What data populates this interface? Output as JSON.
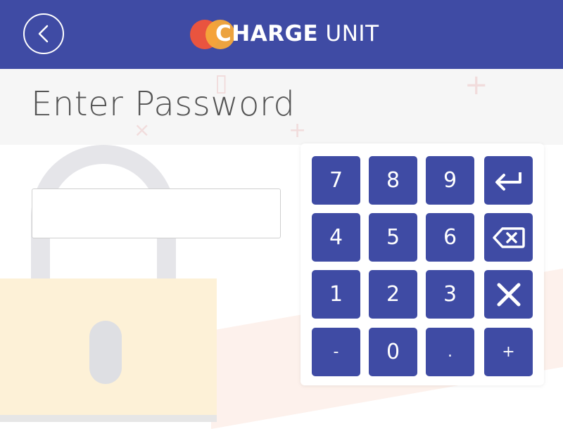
{
  "header": {
    "brand_bold": "CHARGE",
    "brand_light": "UNIT",
    "background": "#3f4ba4",
    "logo_colors": [
      "#e9543f",
      "#f6a83a"
    ]
  },
  "main": {
    "title": "Enter Password",
    "password": {
      "value": "",
      "placeholder": ""
    }
  },
  "keypad": {
    "keys": [
      "7",
      "8",
      "9",
      "enter",
      "4",
      "5",
      "6",
      "backspace",
      "1",
      "2",
      "3",
      "clear",
      "-",
      "0",
      ".",
      "+"
    ],
    "icons": {
      "enter": "enter-icon",
      "backspace": "backspace-icon",
      "clear": "close-icon"
    },
    "key_color": "#3f4ba4"
  },
  "icons": {
    "back": "back-arrow-icon",
    "lock": "padlock-illustration"
  }
}
